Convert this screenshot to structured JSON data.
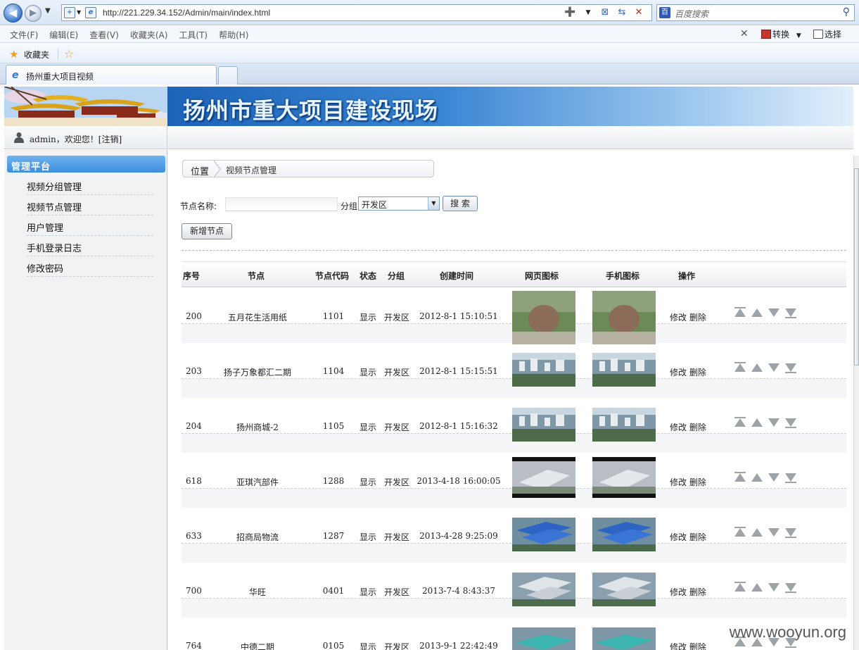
{
  "browser": {
    "url": "http://221.229.34.152/Admin/main/index.html",
    "search_placeholder": "百度搜索",
    "menu": [
      "文件(F)",
      "编辑(E)",
      "查看(V)",
      "收藏夹(A)",
      "工具(T)",
      "帮助(H)"
    ],
    "convert_label": "转换",
    "select_label": "选择",
    "favorites_label": "收藏夹",
    "tab_title": "扬州重大项目视频"
  },
  "header": {
    "title": "扬州市重大项目建设现场"
  },
  "user": {
    "text": "admin，欢迎您！[注销]"
  },
  "sidebar": {
    "title": "管理平台",
    "items": [
      {
        "label": "视频分组管理"
      },
      {
        "label": "视频节点管理"
      },
      {
        "label": "用户管理"
      },
      {
        "label": "手机登录日志"
      },
      {
        "label": "修改密码"
      }
    ]
  },
  "breadcrumb": {
    "position": "位置",
    "current": "视频节点管理"
  },
  "search": {
    "node_label": "节点名称:",
    "node_value": "",
    "group_label": "分组",
    "group_value": "开发区",
    "search_button": "搜 索"
  },
  "add_button": "新增节点",
  "table": {
    "columns": [
      "序号",
      "节点",
      "节点代码",
      "状态",
      "分组",
      "创建时间",
      "网页图标",
      "手机图标",
      "操作"
    ],
    "edit_label": "修改",
    "delete_label": "删除",
    "rows": [
      {
        "id": "200",
        "node": "五月花生活用纸",
        "code": "1101",
        "status": "显示",
        "group": "开发区",
        "created": "2012-8-1 15:10:51",
        "thumb": "rock"
      },
      {
        "id": "203",
        "node": "扬子万象都汇二期",
        "code": "1104",
        "status": "显示",
        "group": "开发区",
        "created": "2012-8-1 15:15:51",
        "thumb": "city"
      },
      {
        "id": "204",
        "node": "扬州商城-2",
        "code": "1105",
        "status": "显示",
        "group": "开发区",
        "created": "2012-8-1 15:16:32",
        "thumb": "city"
      },
      {
        "id": "618",
        "node": "亚琪汽部件",
        "code": "1288",
        "status": "显示",
        "group": "开发区",
        "created": "2013-4-18 16:00:05",
        "thumb": "factory-dark"
      },
      {
        "id": "633",
        "node": "招商局物流",
        "code": "1287",
        "status": "显示",
        "group": "开发区",
        "created": "2013-4-28 9:25:09",
        "thumb": "blue-roofs"
      },
      {
        "id": "700",
        "node": "华旺",
        "code": "0401",
        "status": "显示",
        "group": "开发区",
        "created": "2013-7-4 8:43:37",
        "thumb": "factory"
      },
      {
        "id": "764",
        "node": "中德二期",
        "code": "0105",
        "status": "显示",
        "group": "开发区",
        "created": "2013-9-1 22:42:49",
        "thumb": "teal-roofs"
      }
    ]
  },
  "watermark": "www.wooyun.org"
}
